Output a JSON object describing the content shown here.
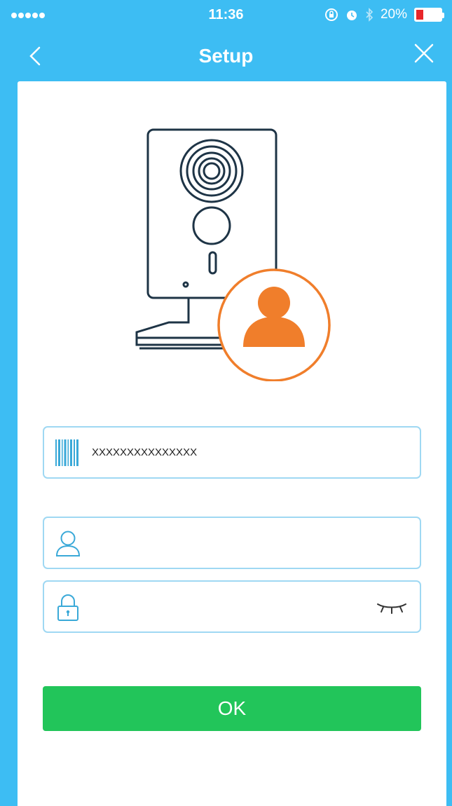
{
  "status_bar": {
    "time": "11:36",
    "battery_text": "20%",
    "icons": [
      "signal-dots",
      "orientation-lock-icon",
      "alarm-icon",
      "bluetooth-icon",
      "battery-icon"
    ]
  },
  "navbar": {
    "title": "Setup",
    "back_icon": "chevron-left-icon",
    "close_icon": "close-icon"
  },
  "illustration": {
    "icons": [
      "camera-icon",
      "user-avatar-icon"
    ],
    "accent": "#f07e2b",
    "outline": "#1e3446"
  },
  "form": {
    "serial": {
      "icon": "barcode-icon",
      "value": "XXXXXXXXXXXXXXX"
    },
    "username": {
      "icon": "user-icon",
      "value": "",
      "placeholder": ""
    },
    "password": {
      "icon": "lock-icon",
      "value": "",
      "placeholder": "",
      "toggle_icon": "eye-closed-icon"
    }
  },
  "ok_button": {
    "label": "OK"
  },
  "colors": {
    "header": "#3dbdf3",
    "field_border": "#9fd8f3",
    "button": "#22c55a",
    "icon": "#3aa9d8"
  }
}
